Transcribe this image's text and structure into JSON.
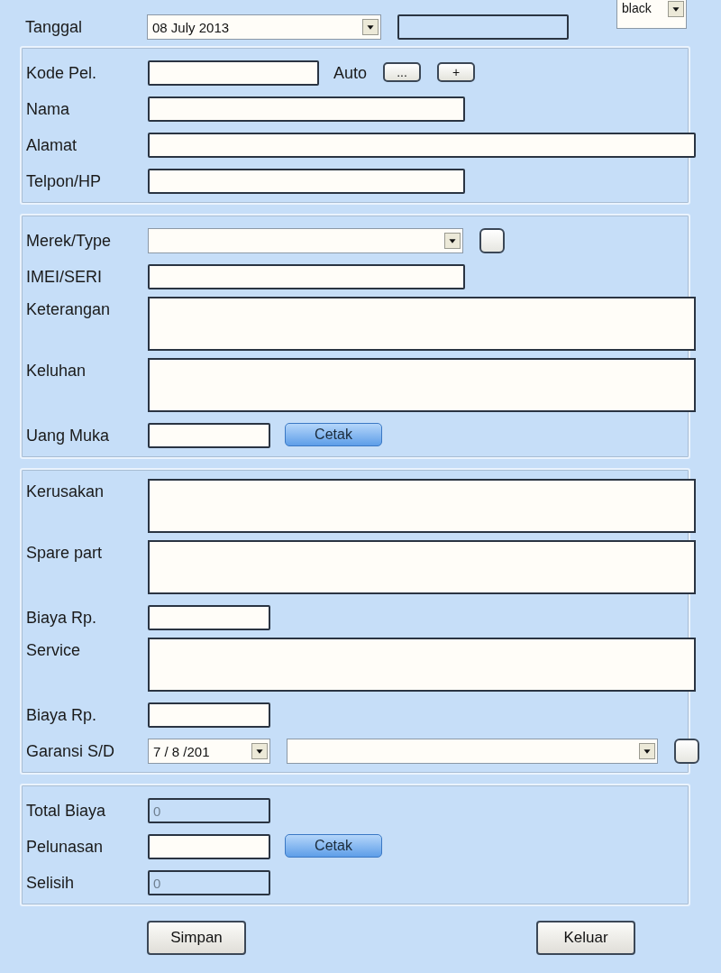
{
  "header": {
    "label": "Tanggal",
    "controls": [
      {
        "kind": "date",
        "value": "08 July 2013"
      },
      {
        "kind": "field",
        "disabled": true
      },
      {
        "kind": "smallcombo",
        "value": "black"
      }
    ]
  },
  "sections": [
    {
      "rows": [
        {
          "label": "Kode Pel.",
          "controls": [
            {
              "kind": "field",
              "disabled": false
            },
            {
              "kind": "caption",
              "text": "Auto"
            },
            {
              "kind": "button",
              "text": "..."
            },
            {
              "kind": "button",
              "text": "+"
            }
          ]
        },
        {
          "label": "Nama",
          "controls": [
            {
              "kind": "longfield",
              "disabled": false
            }
          ]
        },
        {
          "label": "Alamat",
          "controls": [
            {
              "kind": "widefield",
              "disabled": false
            }
          ]
        },
        {
          "label": "Telpon/HP",
          "controls": [
            {
              "kind": "longfield",
              "disabled": false
            }
          ]
        }
      ]
    },
    {
      "rows": [
        {
          "label": "Merek/Type",
          "controls": [
            {
              "kind": "combo"
            },
            {
              "kind": "squarebutton"
            }
          ]
        },
        {
          "label": "IMEI/SERI",
          "controls": [
            {
              "kind": "longfield",
              "disabled": false
            }
          ]
        },
        {
          "label": "Keterangan",
          "controls": [
            {
              "kind": "memo"
            }
          ]
        },
        {
          "label": "Keluhan",
          "controls": [
            {
              "kind": "memo"
            }
          ]
        },
        {
          "label": "Uang Muka",
          "controls": [
            {
              "kind": "shortfield",
              "disabled": false
            },
            {
              "kind": "bluebutton",
              "text": "Cetak"
            }
          ]
        }
      ]
    },
    {
      "rows": [
        {
          "label": "Kerusakan",
          "controls": [
            {
              "kind": "memo"
            }
          ]
        },
        {
          "label": "Spare part",
          "controls": [
            {
              "kind": "memo"
            }
          ]
        },
        {
          "label": "Biaya Rp.",
          "controls": [
            {
              "kind": "shortfield",
              "disabled": false
            }
          ]
        },
        {
          "label": "Service",
          "controls": [
            {
              "kind": "memo"
            }
          ]
        },
        {
          "label": "Biaya Rp.",
          "controls": [
            {
              "kind": "shortfield",
              "disabled": false
            }
          ]
        },
        {
          "label": "Garansi S/D",
          "controls": [
            {
              "kind": "shortdate",
              "value": "7 / 8 /201"
            },
            {
              "kind": "widecombo"
            },
            {
              "kind": "squarebutton"
            }
          ]
        }
      ]
    },
    {
      "rows": [
        {
          "label": "Total Biaya",
          "controls": [
            {
              "kind": "shortfield",
              "disabled": true,
              "value": "0"
            }
          ]
        },
        {
          "label": "Pelunasan",
          "controls": [
            {
              "kind": "shortfield",
              "disabled": false
            },
            {
              "kind": "bluebutton",
              "text": "Cetak"
            }
          ]
        },
        {
          "label": "Selisih",
          "controls": [
            {
              "kind": "shortfield",
              "disabled": true,
              "value": "0"
            }
          ]
        }
      ]
    }
  ],
  "buttons": [
    {
      "text": "Simpan"
    },
    {
      "text": "Keluar"
    }
  ]
}
